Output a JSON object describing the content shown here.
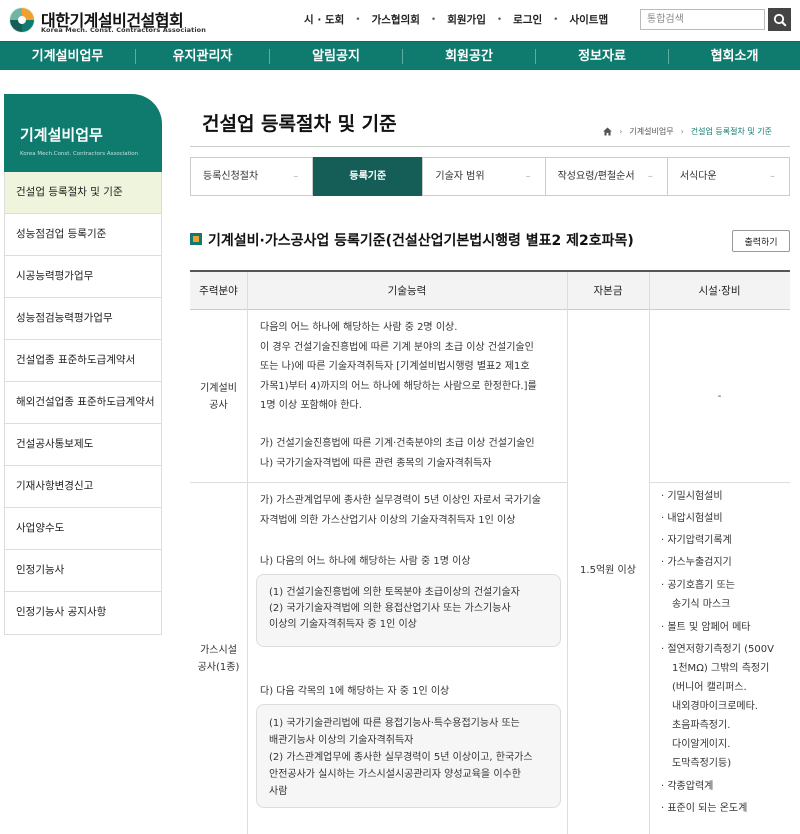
{
  "header": {
    "logo_title": "대한기계설비건설협회",
    "logo_sub": "Korea Mech. Const. Contractors Association",
    "util_links": [
      "시 · 도회",
      "가스협의회",
      "회원가입",
      "로그인",
      "사이트맵"
    ],
    "search_placeholder": "통합검색"
  },
  "gnb": [
    "기계설비업무",
    "유지관리자",
    "알림공지",
    "회원공간",
    "정보자료",
    "협회소개"
  ],
  "lnb": {
    "title": "기계설비업무",
    "sub": "Korea Mech.Const. Contractors Association",
    "items": [
      "건설업 등록절차 및 기준",
      "성능점검업 등록기준",
      "시공능력평가업무",
      "성능점검능력평가업무",
      "건설업종 표준하도급계약서",
      "해외건설업종 표준하도급계약서",
      "건설공사통보제도",
      "기재사항변경신고",
      "사업양수도",
      "인정기능사",
      "인정기능사 공지사항"
    ]
  },
  "content": {
    "title": "건설업 등록절차 및 기준",
    "breadcrumb": [
      "기계설비업무",
      "건설업 등록절차 및 기준"
    ],
    "tabs": [
      "등록신청절차",
      "등록기준",
      "기술자 범위",
      "작성요령/편철순서",
      "서식다운"
    ],
    "tab_dash": "–",
    "section_title": "기계설비·가스공사업 등록기준(건설산업기본법시행령 별표2 제2호파목)",
    "print_label": "출력하기"
  },
  "table": {
    "headers": [
      "주력분야",
      "기술능력",
      "자본금",
      "시설·장비"
    ],
    "row1": {
      "category": [
        "기계설비",
        "공사"
      ],
      "lines": [
        "다음의 어느 하나에 해당하는 사람 중 2명 이상.",
        "이 경우 건설기술진흥법에 따른 기계 분야의 초급 이상 건설기술인",
        "또는 나)에 따른 기술자격취득자 [기계설비법시행령 별표2 제1호",
        "가목1)부터 4)까지의 어느 하나에 해당하는 사람으로 한정한다.]를",
        "1명 이상 포함해야 한다."
      ],
      "lines2": [
        "가) 건설기술진흥법에 따른 기계·건축분야의 초급 이상 건설기술인",
        "나) 국가기술자격법에 따른 관련 종목의 기술자격취득자"
      ],
      "equipment": "-"
    },
    "row2": {
      "category": [
        "가스시설",
        "공사(1종)"
      ],
      "a_lines": [
        "가) 가스관계업무에 종사한 실무경력이 5년 이상인 자로서 국가기술",
        "자격법에 의한 가스산업기사 이상의 기술자격취득자 1인 이상"
      ],
      "b_title": "나) 다음의 어느 하나에 해당하는 사람 중 1명 이상",
      "b_box": [
        "(1) 건설기술진흥법에 의한 토목분야 초급이상의 건설기술자",
        "(2) 국가기술자격법에 의한 용접산업기사 또는 가스기능사",
        "이상의 기술자격취득자 중 1인 이상"
      ],
      "c_title": "다) 다음 각목의 1에 해당하는 자 중 1인 이상",
      "c_box": [
        "(1) 국가기술관리법에 따른 용접기능사·특수용접기능사 또는",
        "배관기능사 이상의 기술자격취득자",
        "(2) 가스관계업무에 종사한 실무경력이 5년 이상이고, 한국가스",
        "안전공사가 실시하는 가스시설시공관리자 양성교육을 이수한",
        "사람"
      ]
    },
    "capital": "1.5억원 이상",
    "equipment_list": [
      "· 기밀시험설비",
      "· 내압시험설비",
      "· 자기압력기록계",
      "· 가스누출검지기",
      "· 공기호흡기 또는",
      "송기식 마스크",
      "· 볼트 및 암페어 메타",
      "· 절연저항기측정기 (500V",
      "1천MΩ) 그밖의 측정기",
      "(버니어 캘리퍼스.",
      "내외경마이크로메타.",
      "초음파측정기.",
      "다이알게이지.",
      "도막측정기등)",
      "· 각종압력계",
      "· 표준이 되는 온도계"
    ]
  },
  "colors": {
    "brand": "#0f7b6f",
    "active_tab": "#155e57",
    "accent": "#f0a030"
  }
}
